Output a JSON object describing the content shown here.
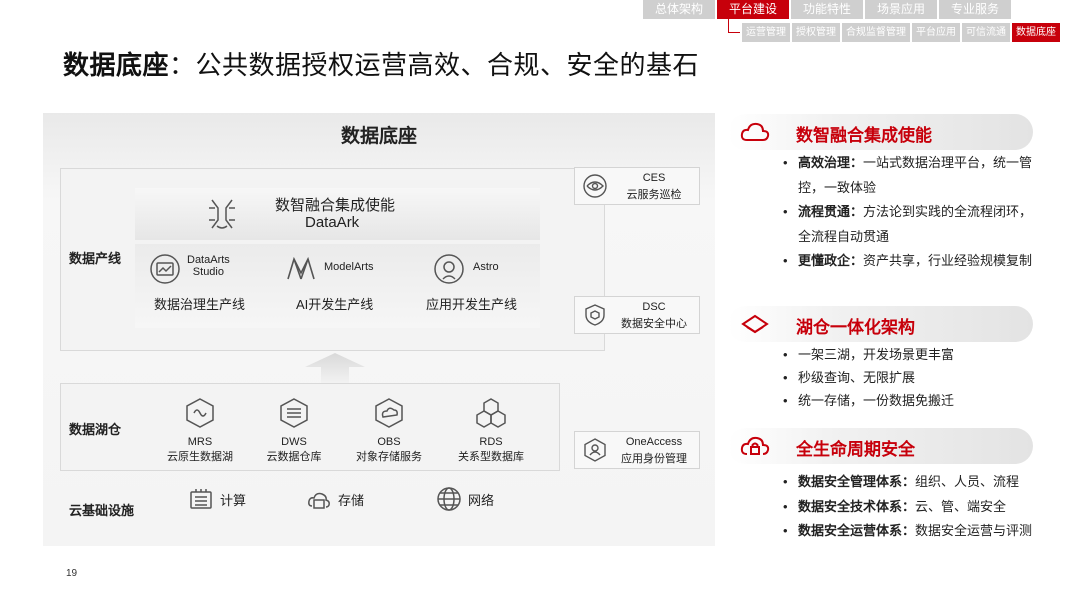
{
  "nav": {
    "tabs": [
      "总体架构",
      "平台建设",
      "功能特性",
      "场景应用",
      "专业服务"
    ],
    "subtabs": [
      "运营管理",
      "授权管理",
      "合规监督管理",
      "平台应用",
      "可信流通",
      "数据底座"
    ]
  },
  "title": {
    "bold": "数据底座",
    "rest": "：公共数据授权运营高效、合规、安全的基石"
  },
  "diagram": {
    "title": "数据底座",
    "layer_prod": "数据产线",
    "layer_lake": "数据湖仓",
    "layer_infra": "云基础设施",
    "dataark": {
      "name": "数智融合集成使能",
      "sub": "DataArk"
    },
    "lines": [
      {
        "name": "DataArts\nStudio",
        "label": "数据治理生产线"
      },
      {
        "name": "ModelArts",
        "label": "AI开发生产线"
      },
      {
        "name": "Astro",
        "label": "应用开发生产线"
      }
    ],
    "lake": [
      {
        "name": "MRS",
        "label": "云原生数据湖"
      },
      {
        "name": "DWS",
        "label": "云数据仓库"
      },
      {
        "name": "OBS",
        "label": "对象存储服务"
      },
      {
        "name": "RDS",
        "label": "关系型数据库"
      }
    ],
    "infra": [
      "计算",
      "存储",
      "网络"
    ],
    "side": [
      {
        "t1": "CES",
        "t2": "云服务巡检"
      },
      {
        "t1": "DSC",
        "t2": "数据安全中心"
      },
      {
        "t1": "OneAccess",
        "t2": "应用身份管理"
      }
    ]
  },
  "sections": [
    {
      "title": "数智融合集成使能",
      "bullets": [
        {
          "bold": "高效治理：",
          "text": "一站式数据治理平台，统一管控，一致体验"
        },
        {
          "bold": "流程贯通：",
          "text": "方法论到实践的全流程闭环，全流程自动贯通"
        },
        {
          "bold": "更懂政企：",
          "text": "资产共享，行业经验规模复制"
        }
      ]
    },
    {
      "title": "湖仓一体化架构",
      "bullets": [
        {
          "bold": "",
          "text": "一架三湖，开发场景更丰富"
        },
        {
          "bold": "",
          "text": "秒级查询、无限扩展"
        },
        {
          "bold": "",
          "text": "统一存储，一份数据免搬迁"
        }
      ]
    },
    {
      "title": "全生命周期安全",
      "bullets": [
        {
          "bold": "数据安全管理体系：",
          "text": "组织、人员、流程"
        },
        {
          "bold": "数据安全技术体系：",
          "text": "云、管、端安全"
        },
        {
          "bold": "数据安全运营体系：",
          "text": "数据安全运营与评测"
        }
      ]
    }
  ],
  "page_number": "19",
  "colors": {
    "accent": "#c7000b",
    "nav_gray": "#cfcfcf"
  }
}
